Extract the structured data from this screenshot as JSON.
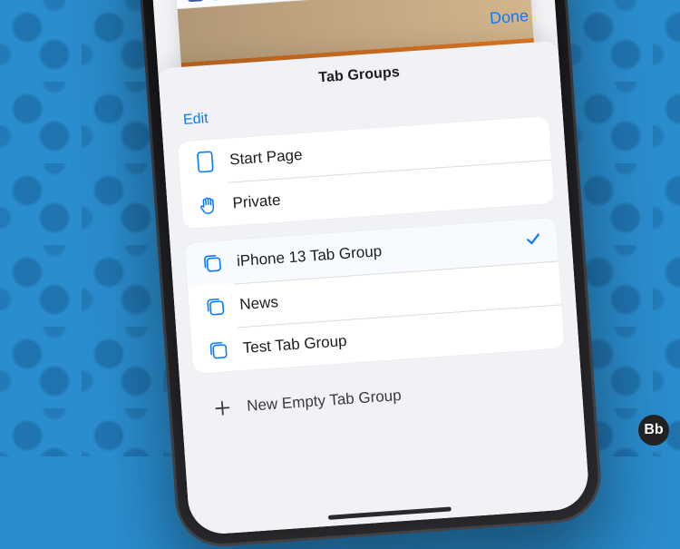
{
  "colors": {
    "accent": "#0a7aff"
  },
  "header": {
    "done": "Done"
  },
  "sheet": {
    "title": "Tab Groups",
    "edit": "Edit",
    "fixed_items": [
      {
        "icon": "tab-icon",
        "label": "Start Page"
      },
      {
        "icon": "hand-icon",
        "label": "Private"
      }
    ],
    "groups": [
      {
        "label": "iPhone 13 Tab Group",
        "selected": true
      },
      {
        "label": "News",
        "selected": false
      },
      {
        "label": "Test Tab Group",
        "selected": false
      }
    ],
    "new_label": "New Empty Tab Group"
  },
  "watermark": "Bb"
}
